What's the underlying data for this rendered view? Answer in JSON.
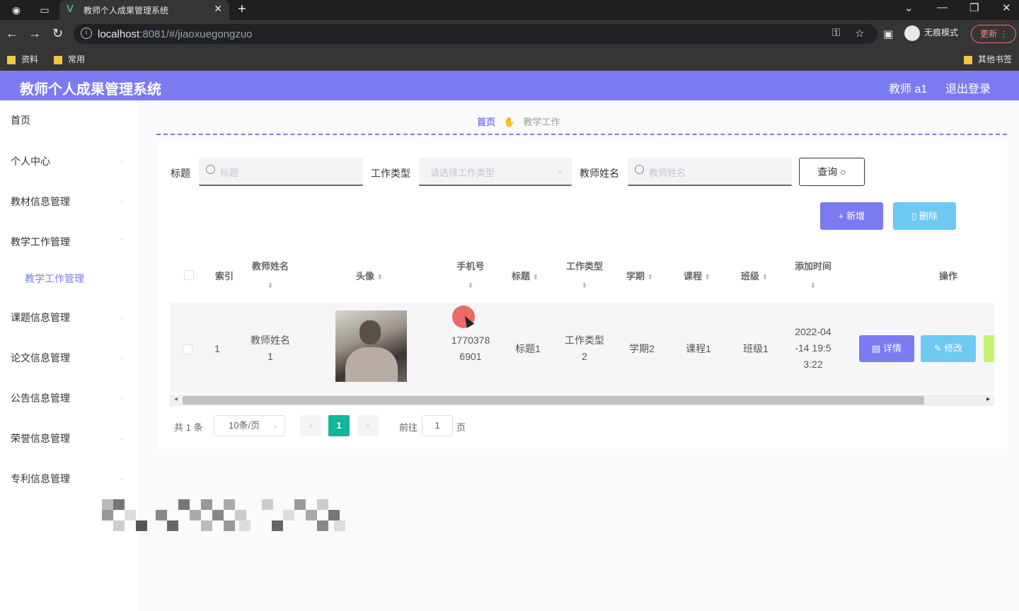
{
  "browser": {
    "tab_title": "教师个人成果管理系统",
    "url_host": "localhost",
    "url_rest": ":8081/#/jiaoxuegongzuo",
    "incognito_label": "无痕模式",
    "update_label": "更新",
    "bookmarks": [
      "资料",
      "常用"
    ],
    "other_bookmarks": "其他书签"
  },
  "header": {
    "brand": "教师个人成果管理系统",
    "user": "教师 a1",
    "logout": "退出登录",
    "accent": "#7b7bf1"
  },
  "sidebar": {
    "items": [
      "首页",
      "个人中心",
      "教材信息管理",
      "教学工作管理",
      "教学工作管理",
      "课题信息管理",
      "论文信息管理",
      "公告信息管理",
      "荣誉信息管理",
      "专利信息管理"
    ]
  },
  "breadcrumb": {
    "home": "首页",
    "current": "教学工作"
  },
  "filters": {
    "title_label": "标题",
    "title_placeholder": "标题",
    "type_label": "工作类型",
    "type_placeholder": "请选择工作类型",
    "teacher_label": "教师姓名",
    "teacher_placeholder": "教师姓名",
    "query_button": "查询"
  },
  "actions": {
    "add": "新增",
    "delete": "删除"
  },
  "table": {
    "headers": {
      "index": "索引",
      "teacher": "教师姓名",
      "avatar": "头像",
      "phone": "手机号",
      "title": "标题",
      "type": "工作类型",
      "term": "学期",
      "course": "课程",
      "class": "班级",
      "added": "添加时间",
      "ops": "操作"
    },
    "rows": [
      {
        "index": "1",
        "teacher_a": "教师姓名",
        "teacher_b": "1",
        "phone_a": "1770378",
        "phone_b": "6901",
        "title": "标题1",
        "type_a": "工作类型",
        "type_b": "2",
        "term": "学期2",
        "course": "课程1",
        "class": "班级1",
        "added_a": "2022-04",
        "added_b": "-14 19:5",
        "added_c": "3:22",
        "detail": "详情",
        "edit": "修改"
      }
    ]
  },
  "pagination": {
    "total": "共 1 条",
    "page_size": "10条/页",
    "current": "1",
    "goto_prefix": "前往",
    "goto_value": "1",
    "goto_suffix": "页"
  }
}
